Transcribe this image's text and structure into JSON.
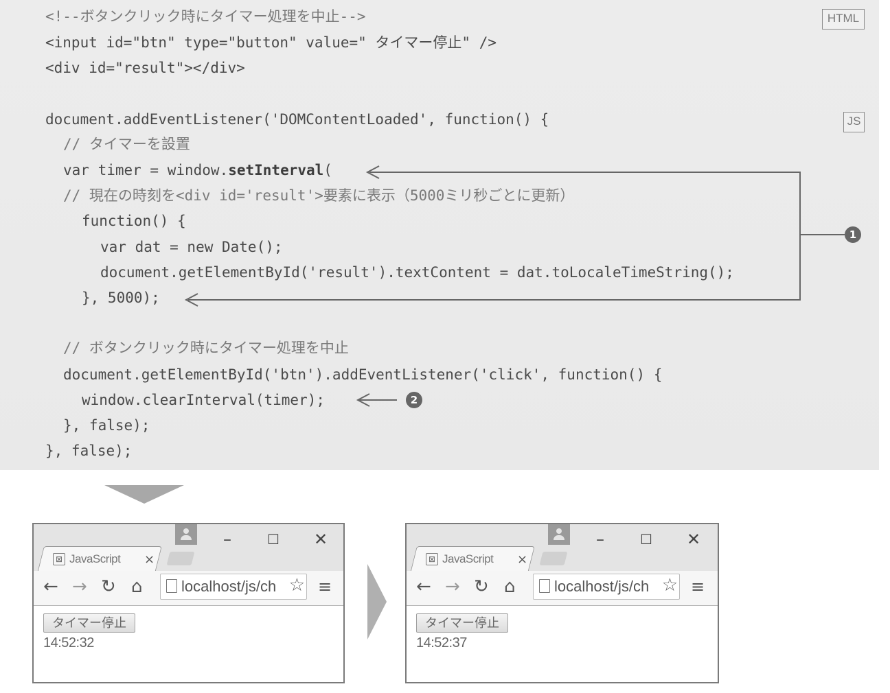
{
  "badges": {
    "html": "HTML",
    "js": "JS"
  },
  "code_lines": [
    "<!--ボタンクリック時にタイマー処理を中止-->",
    "<input id=\"btn\" type=\"button\" value=\" タイマー停止\" />",
    "<div id=\"result\"></div>",
    "document.addEventListener('DOMContentLoaded', function() {",
    "// タイマーを設置",
    "var timer = window.",
    "setInterval",
    "(",
    "// 現在の時刻を<div id='result'>要素に表示（5000ミリ秒ごとに更新）",
    "function() {",
    "var dat = new Date();",
    "document.getElementById('result').textContent = dat.toLocaleTimeString();",
    "}, 5000);",
    "// ボタンクリック時にタイマー処理を中止",
    "document.getElementById('btn').addEventListener('click', function() {",
    "window.clearInterval(timer);",
    "}, false);",
    "}, false);"
  ],
  "markers": {
    "one": "1",
    "two": "2"
  },
  "browsers": [
    {
      "tab_title": "JavaScript",
      "tab_close": "×",
      "favicon": "⊠",
      "win_minimize": "–",
      "win_maximize": "☐",
      "win_close": "✕",
      "nav_back": "←",
      "nav_forward": "→",
      "nav_reload": "↻",
      "nav_home": "⌂",
      "url": "localhost/js/ch",
      "star": "☆",
      "menu": "≡",
      "button_label": "タイマー停止",
      "result_time": "14:52:32"
    },
    {
      "tab_title": "JavaScript",
      "tab_close": "×",
      "favicon": "⊠",
      "win_minimize": "–",
      "win_maximize": "☐",
      "win_close": "✕",
      "nav_back": "←",
      "nav_forward": "→",
      "nav_reload": "↻",
      "nav_home": "⌂",
      "url": "localhost/js/ch",
      "star": "☆",
      "menu": "≡",
      "button_label": "タイマー停止",
      "result_time": "14:52:37"
    }
  ],
  "colors": {
    "code_bg": "#ebebeb",
    "code_text": "#4a4a4a",
    "marker_bg": "#666666"
  }
}
